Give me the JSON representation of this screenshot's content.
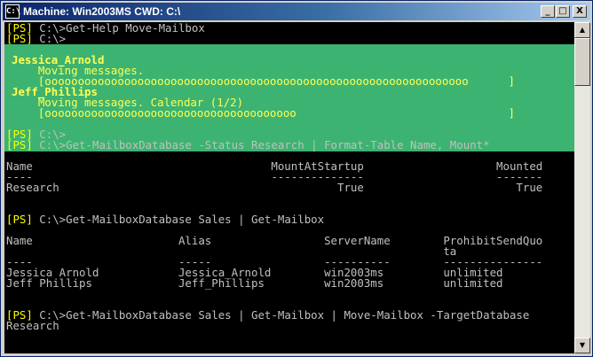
{
  "window": {
    "title": "Machine: Win2003MS CWD: C:\\",
    "icon_label": "C:\\",
    "buttons": {
      "minimize": "_",
      "maximize": "□",
      "close": "X"
    }
  },
  "scrollbar": {
    "up_arrow": "▲",
    "down_arrow": "▼"
  },
  "console": {
    "top_lines": [
      {
        "prompt": "[PS]",
        "text": " C:\\>Get-Help Move-Mailbox"
      },
      {
        "prompt": "[PS]",
        "text": " C:\\>"
      }
    ],
    "progress": [
      {
        "text": "Jessica_Arnold",
        "bold": true
      },
      {
        "text": "    Moving messages.",
        "bold": false
      },
      {
        "text": "    [oooooooooooooooooooooooooooooooooooooooooooooooooooooooooooooooo      ]",
        "bold": false
      },
      {
        "text": "Jeff_Phillips",
        "bold": true
      },
      {
        "text": "    Moving messages. Calendar (1/2)",
        "bold": false
      },
      {
        "text": "    [oooooooooooooooooooooooooooooooooooooo                                ]",
        "bold": false
      }
    ],
    "lines": [
      {
        "prompt": "[PS]",
        "text": " C:\\>"
      },
      {
        "prompt": "[PS]",
        "text": " C:\\>Get-MailboxDatabase -Status Research | Format-Table Name, Mount*"
      },
      {
        "prompt": "",
        "text": ""
      },
      {
        "prompt": "",
        "text": "Name                                    MountAtStartup                    Mounted"
      },
      {
        "prompt": "",
        "text": "----                                    --------------                    -------"
      },
      {
        "prompt": "",
        "text": "Research                                          True                       True"
      },
      {
        "prompt": "",
        "text": ""
      },
      {
        "prompt": "",
        "text": ""
      },
      {
        "prompt": "[PS]",
        "text": " C:\\>Get-MailboxDatabase Sales | Get-Mailbox"
      },
      {
        "prompt": "",
        "text": ""
      },
      {
        "prompt": "",
        "text": "Name                      Alias                 ServerName        ProhibitSendQuo"
      },
      {
        "prompt": "",
        "text": "                                                                  ta"
      },
      {
        "prompt": "",
        "text": "----                      -----                 ----------        ---------------"
      },
      {
        "prompt": "",
        "text": "Jessica Arnold            Jessica_Arnold        win2003ms         unlimited"
      },
      {
        "prompt": "",
        "text": "Jeff Phillips             Jeff_Phillips         win2003ms         unlimited"
      },
      {
        "prompt": "",
        "text": ""
      },
      {
        "prompt": "",
        "text": ""
      },
      {
        "prompt": "[PS]",
        "text": " C:\\>Get-MailboxDatabase Sales | Get-Mailbox | Move-Mailbox -TargetDatabase"
      },
      {
        "prompt": "",
        "text": "Research"
      }
    ]
  }
}
